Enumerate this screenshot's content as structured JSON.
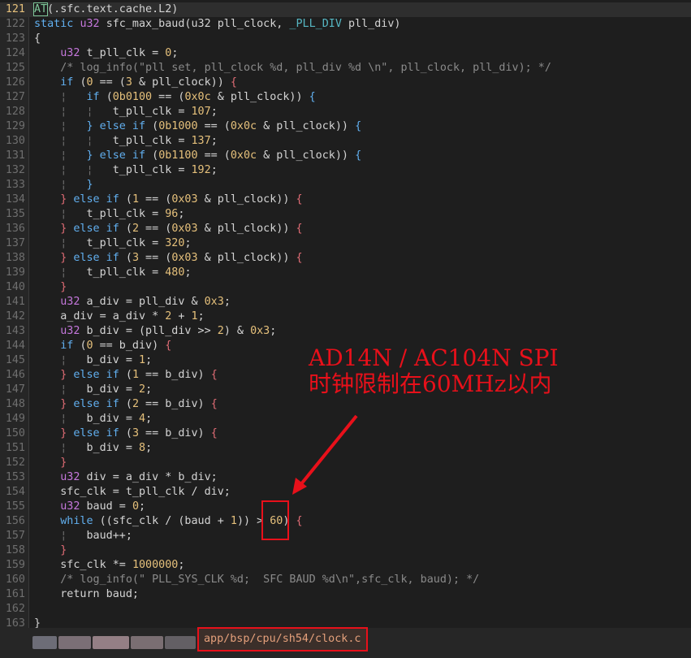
{
  "editor": {
    "current_line": 121,
    "lines": [
      {
        "n": 121,
        "code": [
          [
            "kw",
            "AT"
          ],
          [
            "fn",
            "(.sfc.text.cache.L2)"
          ]
        ]
      },
      {
        "n": 122,
        "code": [
          [
            "kw",
            "static "
          ],
          [
            "ty",
            "u32 "
          ],
          [
            "fn",
            "sfc_max_baud(u32 pll_clock, "
          ],
          [
            "hl",
            "_PLL_DIV"
          ],
          [
            "fn",
            " pll_div)"
          ]
        ]
      },
      {
        "n": 123,
        "code": [
          [
            "fn",
            "{"
          ]
        ]
      },
      {
        "n": 124,
        "code": [
          [
            "fn",
            "    "
          ],
          [
            "ty",
            "u32 "
          ],
          [
            "fn",
            "t_pll_clk = "
          ],
          [
            "num",
            "0"
          ],
          [
            "fn",
            ";"
          ]
        ]
      },
      {
        "n": 125,
        "code": [
          [
            "cm",
            "    /* log_info(\"pll set, pll_clock %d, pll_div %d \\n\", pll_clock, pll_div); */"
          ]
        ]
      },
      {
        "n": 126,
        "code": [
          [
            "fn",
            "    "
          ],
          [
            "kw",
            "if "
          ],
          [
            "fn",
            "("
          ],
          [
            "num",
            "0"
          ],
          [
            "fn",
            " == ("
          ],
          [
            "num",
            "3"
          ],
          [
            "fn",
            " & pll_clock)) "
          ],
          [
            "br",
            "{"
          ]
        ]
      },
      {
        "n": 127,
        "code": [
          [
            "guide",
            "    ¦   "
          ],
          [
            "kw",
            "if "
          ],
          [
            "fn",
            "("
          ],
          [
            "num",
            "0b0100"
          ],
          [
            "fn",
            " == ("
          ],
          [
            "num",
            "0x0c"
          ],
          [
            "fn",
            " & pll_clock)) "
          ],
          [
            "kw",
            "{"
          ]
        ]
      },
      {
        "n": 128,
        "code": [
          [
            "guide",
            "    ¦   ¦   "
          ],
          [
            "fn",
            "t_pll_clk = "
          ],
          [
            "num",
            "107"
          ],
          [
            "fn",
            ";"
          ]
        ]
      },
      {
        "n": 129,
        "code": [
          [
            "guide",
            "    ¦   "
          ],
          [
            "kw",
            "} else if "
          ],
          [
            "fn",
            "("
          ],
          [
            "num",
            "0b1000"
          ],
          [
            "fn",
            " == ("
          ],
          [
            "num",
            "0x0c"
          ],
          [
            "fn",
            " & pll_clock)) "
          ],
          [
            "kw",
            "{"
          ]
        ]
      },
      {
        "n": 130,
        "code": [
          [
            "guide",
            "    ¦   ¦   "
          ],
          [
            "fn",
            "t_pll_clk = "
          ],
          [
            "num",
            "137"
          ],
          [
            "fn",
            ";"
          ]
        ]
      },
      {
        "n": 131,
        "code": [
          [
            "guide",
            "    ¦   "
          ],
          [
            "kw",
            "} else if "
          ],
          [
            "fn",
            "("
          ],
          [
            "num",
            "0b1100"
          ],
          [
            "fn",
            " == ("
          ],
          [
            "num",
            "0x0c"
          ],
          [
            "fn",
            " & pll_clock)) "
          ],
          [
            "kw",
            "{"
          ]
        ]
      },
      {
        "n": 132,
        "code": [
          [
            "guide",
            "    ¦   ¦   "
          ],
          [
            "fn",
            "t_pll_clk = "
          ],
          [
            "num",
            "192"
          ],
          [
            "fn",
            ";"
          ]
        ]
      },
      {
        "n": 133,
        "code": [
          [
            "guide",
            "    ¦   "
          ],
          [
            "kw",
            "}"
          ]
        ]
      },
      {
        "n": 134,
        "code": [
          [
            "fn",
            "    "
          ],
          [
            "br",
            "} "
          ],
          [
            "kw",
            "else if "
          ],
          [
            "fn",
            "("
          ],
          [
            "num",
            "1"
          ],
          [
            "fn",
            " == ("
          ],
          [
            "num",
            "0x03"
          ],
          [
            "fn",
            " & pll_clock)) "
          ],
          [
            "br",
            "{"
          ]
        ]
      },
      {
        "n": 135,
        "code": [
          [
            "guide",
            "    ¦   "
          ],
          [
            "fn",
            "t_pll_clk = "
          ],
          [
            "num",
            "96"
          ],
          [
            "fn",
            ";"
          ]
        ]
      },
      {
        "n": 136,
        "code": [
          [
            "fn",
            "    "
          ],
          [
            "br",
            "} "
          ],
          [
            "kw",
            "else if "
          ],
          [
            "fn",
            "("
          ],
          [
            "num",
            "2"
          ],
          [
            "fn",
            " == ("
          ],
          [
            "num",
            "0x03"
          ],
          [
            "fn",
            " & pll_clock)) "
          ],
          [
            "br",
            "{"
          ]
        ]
      },
      {
        "n": 137,
        "code": [
          [
            "guide",
            "    ¦   "
          ],
          [
            "fn",
            "t_pll_clk = "
          ],
          [
            "num",
            "320"
          ],
          [
            "fn",
            ";"
          ]
        ]
      },
      {
        "n": 138,
        "code": [
          [
            "fn",
            "    "
          ],
          [
            "br",
            "} "
          ],
          [
            "kw",
            "else if "
          ],
          [
            "fn",
            "("
          ],
          [
            "num",
            "3"
          ],
          [
            "fn",
            " == ("
          ],
          [
            "num",
            "0x03"
          ],
          [
            "fn",
            " & pll_clock)) "
          ],
          [
            "br",
            "{"
          ]
        ]
      },
      {
        "n": 139,
        "code": [
          [
            "guide",
            "    ¦   "
          ],
          [
            "fn",
            "t_pll_clk = "
          ],
          [
            "num",
            "480"
          ],
          [
            "fn",
            ";"
          ]
        ]
      },
      {
        "n": 140,
        "code": [
          [
            "fn",
            "    "
          ],
          [
            "br",
            "}"
          ]
        ]
      },
      {
        "n": 141,
        "code": [
          [
            "fn",
            "    "
          ],
          [
            "ty",
            "u32 "
          ],
          [
            "fn",
            "a_div = pll_div & "
          ],
          [
            "num",
            "0x3"
          ],
          [
            "fn",
            ";"
          ]
        ]
      },
      {
        "n": 142,
        "code": [
          [
            "fn",
            "    a_div = a_div * "
          ],
          [
            "num",
            "2"
          ],
          [
            "fn",
            " + "
          ],
          [
            "num",
            "1"
          ],
          [
            "fn",
            ";"
          ]
        ]
      },
      {
        "n": 143,
        "code": [
          [
            "fn",
            "    "
          ],
          [
            "ty",
            "u32 "
          ],
          [
            "fn",
            "b_div = (pll_div >> "
          ],
          [
            "num",
            "2"
          ],
          [
            "fn",
            ") & "
          ],
          [
            "num",
            "0x3"
          ],
          [
            "fn",
            ";"
          ]
        ]
      },
      {
        "n": 144,
        "code": [
          [
            "fn",
            "    "
          ],
          [
            "kw",
            "if "
          ],
          [
            "fn",
            "("
          ],
          [
            "num",
            "0"
          ],
          [
            "fn",
            " == b_div) "
          ],
          [
            "br",
            "{"
          ]
        ]
      },
      {
        "n": 145,
        "code": [
          [
            "guide",
            "    ¦   "
          ],
          [
            "fn",
            "b_div = "
          ],
          [
            "num",
            "1"
          ],
          [
            "fn",
            ";"
          ]
        ]
      },
      {
        "n": 146,
        "code": [
          [
            "fn",
            "    "
          ],
          [
            "br",
            "} "
          ],
          [
            "kw",
            "else if "
          ],
          [
            "fn",
            "("
          ],
          [
            "num",
            "1"
          ],
          [
            "fn",
            " == b_div) "
          ],
          [
            "br",
            "{"
          ]
        ]
      },
      {
        "n": 147,
        "code": [
          [
            "guide",
            "    ¦   "
          ],
          [
            "fn",
            "b_div = "
          ],
          [
            "num",
            "2"
          ],
          [
            "fn",
            ";"
          ]
        ]
      },
      {
        "n": 148,
        "code": [
          [
            "fn",
            "    "
          ],
          [
            "br",
            "} "
          ],
          [
            "kw",
            "else if "
          ],
          [
            "fn",
            "("
          ],
          [
            "num",
            "2"
          ],
          [
            "fn",
            " == b_div) "
          ],
          [
            "br",
            "{"
          ]
        ]
      },
      {
        "n": 149,
        "code": [
          [
            "guide",
            "    ¦   "
          ],
          [
            "fn",
            "b_div = "
          ],
          [
            "num",
            "4"
          ],
          [
            "fn",
            ";"
          ]
        ]
      },
      {
        "n": 150,
        "code": [
          [
            "fn",
            "    "
          ],
          [
            "br",
            "} "
          ],
          [
            "kw",
            "else if "
          ],
          [
            "fn",
            "("
          ],
          [
            "num",
            "3"
          ],
          [
            "fn",
            " == b_div) "
          ],
          [
            "br",
            "{"
          ]
        ]
      },
      {
        "n": 151,
        "code": [
          [
            "guide",
            "    ¦   "
          ],
          [
            "fn",
            "b_div = "
          ],
          [
            "num",
            "8"
          ],
          [
            "fn",
            ";"
          ]
        ]
      },
      {
        "n": 152,
        "code": [
          [
            "fn",
            "    "
          ],
          [
            "br",
            "}"
          ]
        ]
      },
      {
        "n": 153,
        "code": [
          [
            "fn",
            "    "
          ],
          [
            "ty",
            "u32 "
          ],
          [
            "fn",
            "div = a_div * b_div;"
          ]
        ]
      },
      {
        "n": 154,
        "code": [
          [
            "fn",
            "    sfc_clk = t_pll_clk / div;"
          ]
        ]
      },
      {
        "n": 155,
        "code": [
          [
            "fn",
            "    "
          ],
          [
            "ty",
            "u32 "
          ],
          [
            "fn",
            "baud = "
          ],
          [
            "num",
            "0"
          ],
          [
            "fn",
            ";"
          ]
        ]
      },
      {
        "n": 156,
        "code": [
          [
            "fn",
            "    "
          ],
          [
            "kw",
            "while "
          ],
          [
            "fn",
            "((sfc_clk / (baud + "
          ],
          [
            "num",
            "1"
          ],
          [
            "fn",
            ")) > "
          ],
          [
            "num",
            "60"
          ],
          [
            "fn",
            ") "
          ],
          [
            "br",
            "{"
          ]
        ]
      },
      {
        "n": 157,
        "code": [
          [
            "guide",
            "    ¦   "
          ],
          [
            "fn",
            "baud++;"
          ]
        ]
      },
      {
        "n": 158,
        "code": [
          [
            "fn",
            "    "
          ],
          [
            "br",
            "}"
          ]
        ]
      },
      {
        "n": 159,
        "code": [
          [
            "fn",
            "    sfc_clk *= "
          ],
          [
            "num",
            "1000000"
          ],
          [
            "fn",
            ";"
          ]
        ]
      },
      {
        "n": 160,
        "code": [
          [
            "cm",
            "    /* log_info(\" PLL_SYS_CLK %d;  SFC BAUD %d\\n\",sfc_clk, baud); */"
          ]
        ]
      },
      {
        "n": 161,
        "code": [
          [
            "fn",
            "    return baud;"
          ]
        ]
      },
      {
        "n": 162,
        "code": [
          [
            "fn",
            ""
          ]
        ]
      },
      {
        "n": 163,
        "code": [
          [
            "fn",
            "}"
          ]
        ]
      }
    ]
  },
  "statusbar": {
    "file_path": "app/bsp/cpu/sh54/clock.c"
  },
  "annotation": {
    "text_line1": "AD14N / AC104N SPI",
    "text_line2": "时钟限制在60MHz以内",
    "color": "#e8101a"
  }
}
